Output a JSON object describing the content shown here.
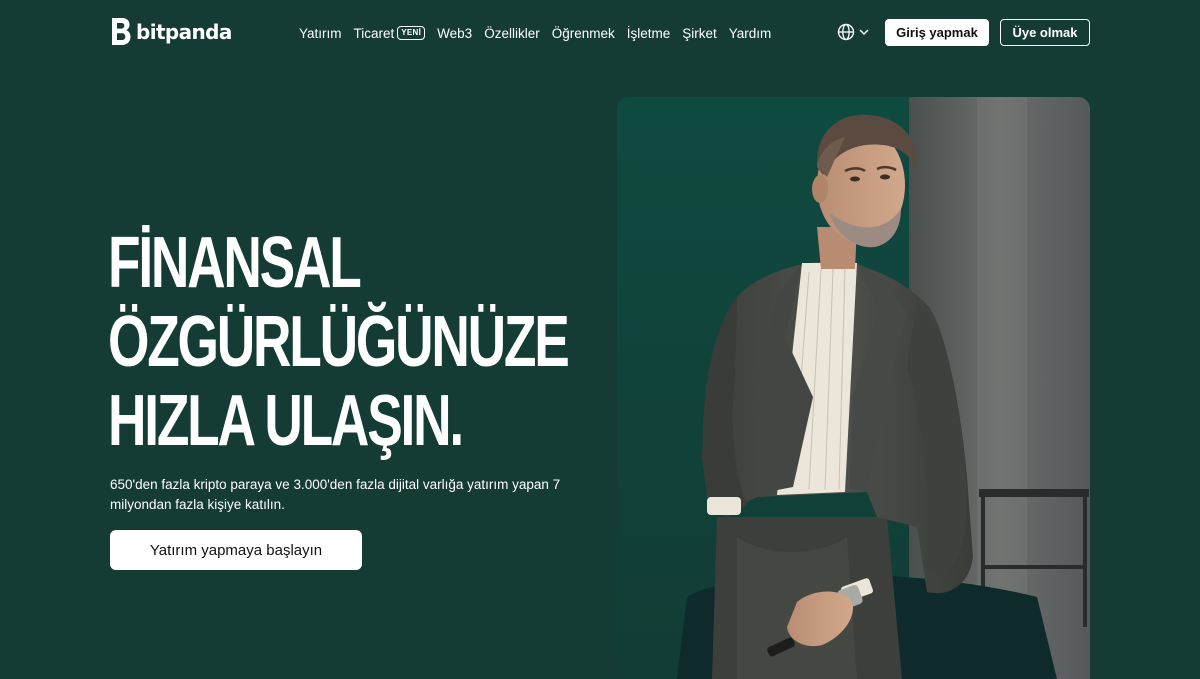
{
  "brand": {
    "name": "bitpanda",
    "logo_icon": "bitpanda-b-logo",
    "colors": {
      "background": "#143b34",
      "accent": "#ffffff",
      "photo_wall": "#15453c"
    }
  },
  "nav": {
    "items": [
      {
        "label": "Yatırım"
      },
      {
        "label": "Ticaret",
        "badge": "YENİ"
      },
      {
        "label": "Web3"
      },
      {
        "label": "Özellikler"
      },
      {
        "label": "Öğrenmek"
      },
      {
        "label": "İşletme"
      },
      {
        "label": "Şirket"
      },
      {
        "label": "Yardım"
      }
    ],
    "language_icon": "globe-icon",
    "login_label": "Giriş yapmak",
    "signup_label": "Üye olmak"
  },
  "hero": {
    "title_lines": [
      "FİNANSAL",
      "ÖZGÜRLÜĞÜNÜZE",
      "HIZLA ULAŞIN."
    ],
    "subtitle": "650'den fazla kripto paraya ve 3.000'den fazla dijital varlığa yatırım yapan 7 milyondan fazla kişiye katılın.",
    "cta_label": "Yatırım yapmaya başlayın"
  }
}
